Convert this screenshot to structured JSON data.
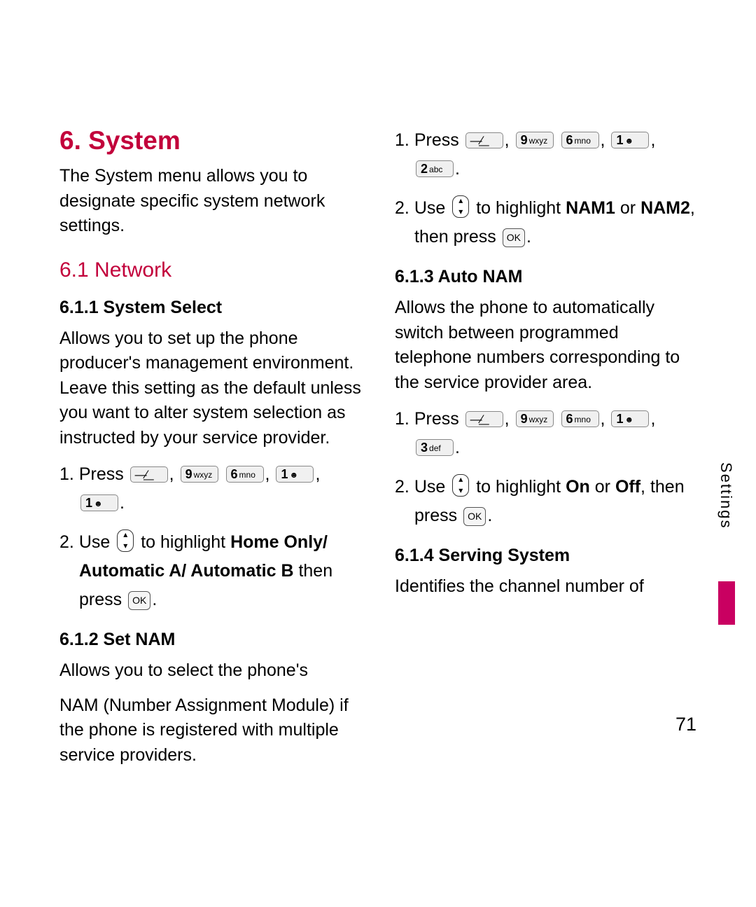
{
  "heading": "6. System",
  "intro": "The System menu allows you to designate specific system network settings.",
  "sub61": "6.1 Network",
  "s611_h": "6.1.1 System Select",
  "s611_p": "Allows you to set up the phone producer's management environment. Leave this setting as the default unless you want to alter system selection as instructed by your service provider.",
  "press": "Press",
  "use": "Use",
  "to_highlight": "to highlight",
  "then_press": "then press",
  "opts_home": "Home Only/ Automatic A/ Automatic B",
  "s612_h": "6.1.2 Set NAM",
  "s612_p1": "Allows you to select the phone's",
  "s612_p2": "NAM (Number Assignment Module) if the phone is registered with multiple service providers.",
  "nam_opts1": "NAM1",
  "or": "or",
  "nam_opts2": "NAM2",
  "comma_then_press": ", then press",
  "s613_h": "6.1.3 Auto NAM",
  "s613_p": "Allows the phone to automatically switch between programmed telephone numbers corresponding to the service provider area.",
  "on": "On",
  "off": "Off",
  "s614_h": "6.1.4 Serving System",
  "s614_p": "Identifies the channel number of",
  "keys": {
    "menu": "—/",
    "k9": {
      "d": "9",
      "s": "wxyz"
    },
    "k6": {
      "d": "6",
      "s": "mno"
    },
    "k1": {
      "d": "1",
      "s": "☻"
    },
    "k2": {
      "d": "2",
      "s": "abc"
    },
    "k3": {
      "d": "3",
      "s": "def"
    },
    "ok": "OK"
  },
  "side_label": "Settings",
  "page_number": "71",
  "step1": "1.",
  "step2": "2.",
  "period": "."
}
